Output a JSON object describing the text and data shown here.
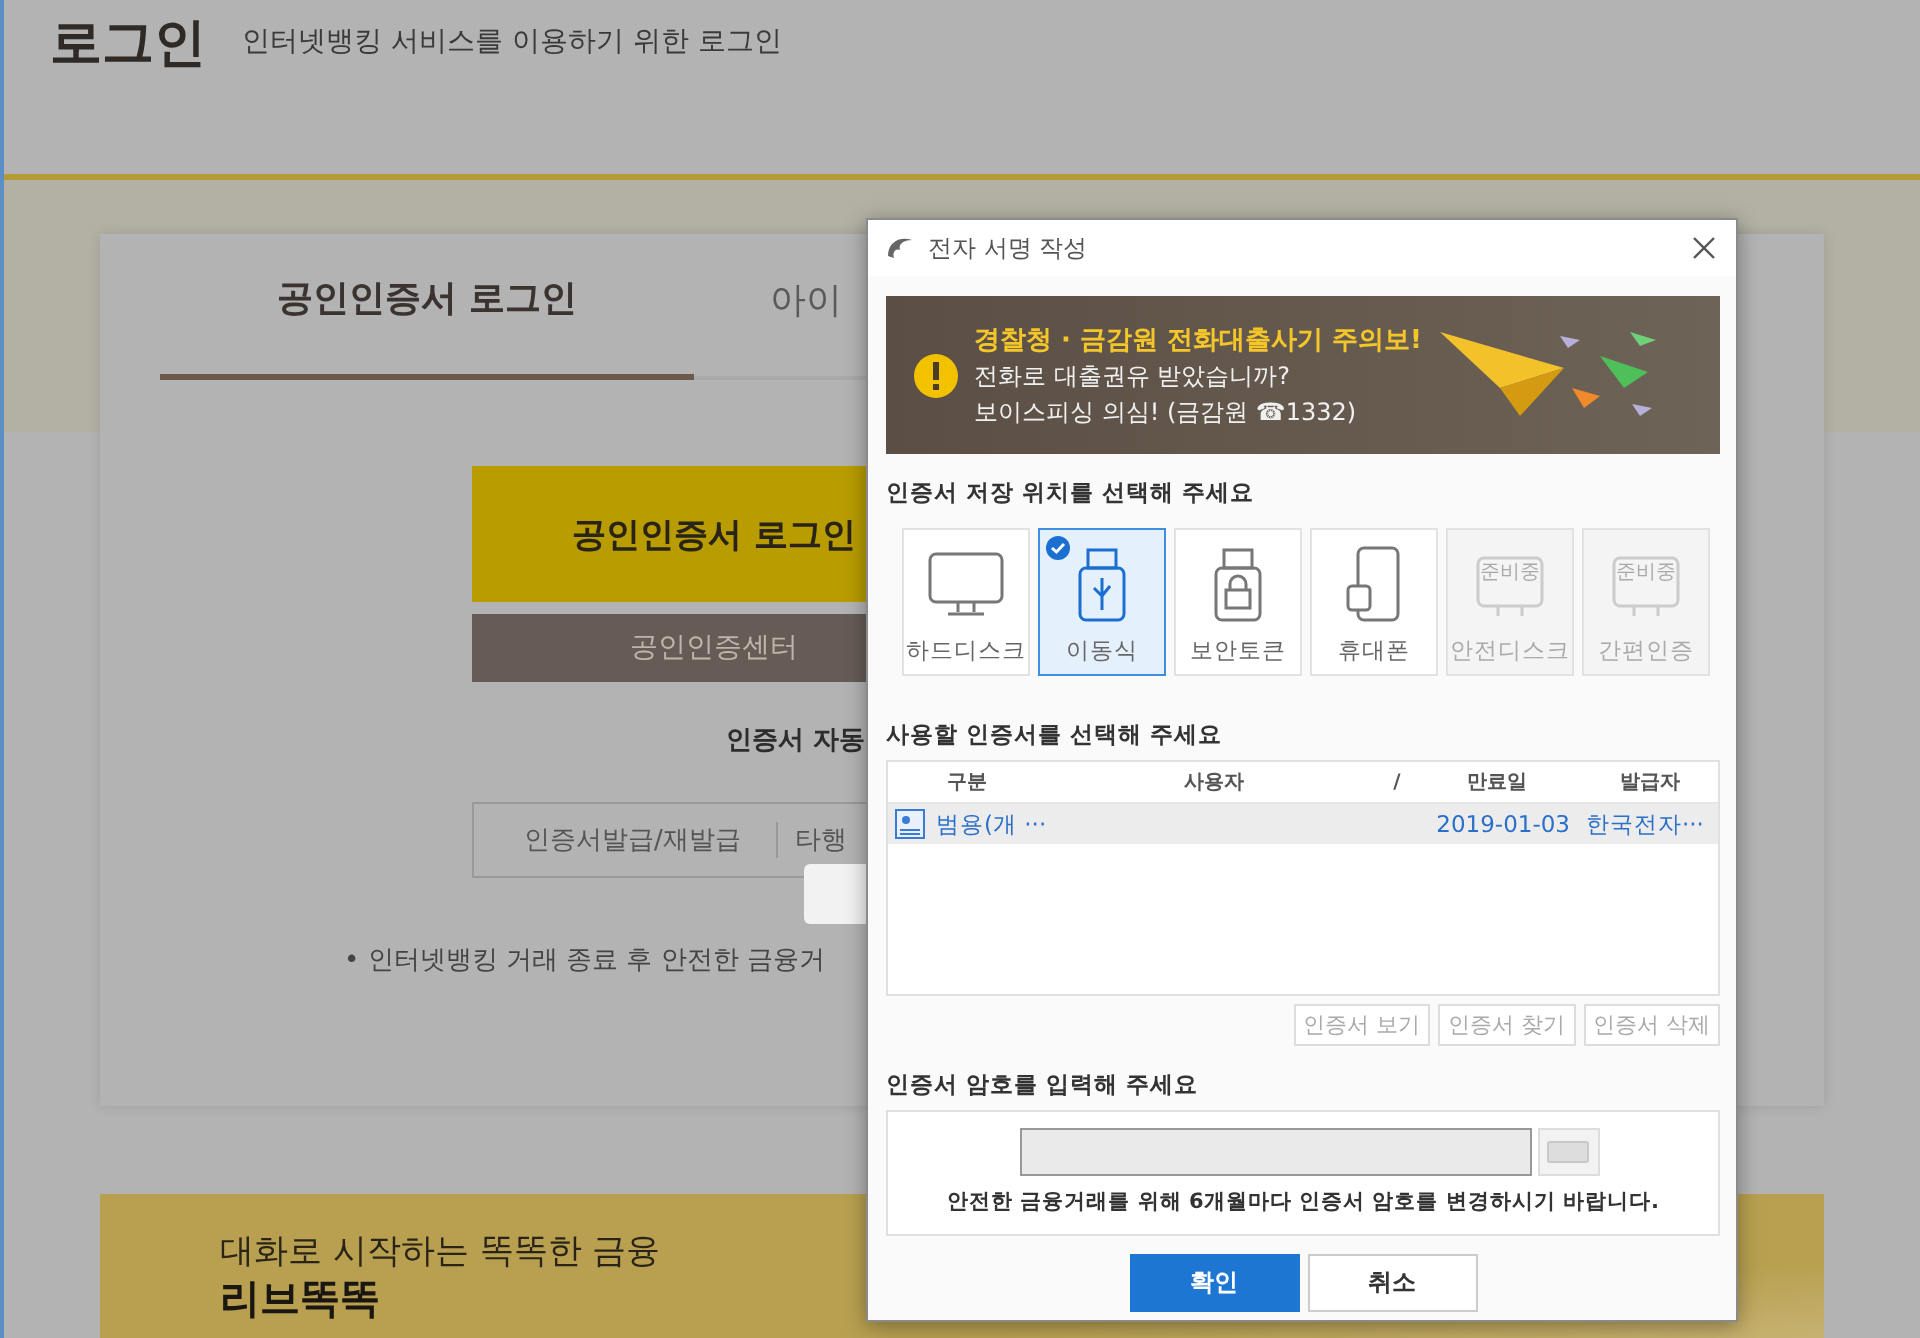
{
  "header": {
    "title": "로그인",
    "subtitle": "인터넷뱅킹 서비스를 이용하기 위한 로그인"
  },
  "login_tabs": [
    {
      "label": "공인인증서 로그인",
      "selected": true
    },
    {
      "label": "아이",
      "selected": false
    }
  ],
  "primary_button": "공인인증서 로그인",
  "center_button": "공인인증센터",
  "auto_label": "인증서 자동",
  "links": [
    "인증서발급/재발급",
    "타행"
  ],
  "notice": "• 인터넷뱅킹 거래 종료 후 안전한 금융거",
  "promo": {
    "line1": "대화로 시작하는 똑똑한 금융",
    "line2": "리브똑똑"
  },
  "dialog": {
    "title": "전자 서명 작성",
    "warning": {
      "headline": "경찰청 · 금감원 전화대출사기 주의보!",
      "lines": [
        "전화로 대출권유 받았습니까?",
        "보이스피싱 의심! (금감원 ☎1332)"
      ]
    },
    "storage_label": "인증서 저장 위치를 선택해 주세요",
    "storage": [
      {
        "label": "하드디스크",
        "kind": "monitor",
        "selected": false,
        "disabled": false
      },
      {
        "label": "이동식",
        "kind": "usb",
        "selected": true,
        "disabled": false
      },
      {
        "label": "보안토큰",
        "kind": "token",
        "selected": false,
        "disabled": false
      },
      {
        "label": "휴대폰",
        "kind": "phone",
        "selected": false,
        "disabled": false
      },
      {
        "label": "안전디스크",
        "kind": "safedisk",
        "selected": false,
        "disabled": true,
        "badge": "준비중"
      },
      {
        "label": "간편인증",
        "kind": "easy",
        "selected": false,
        "disabled": true,
        "badge": "준비중"
      }
    ],
    "cert_label": "사용할 인증서를 선택해 주세요",
    "table": {
      "columns": [
        "구분",
        "사용자",
        "/",
        "만료일",
        "발급자"
      ],
      "rows": [
        {
          "type": "범용(개 ···",
          "expiry": "2019-01-03",
          "issuer": "한국전자···",
          "selected": true
        }
      ]
    },
    "cert_buttons": [
      "인증서 보기",
      "인증서 찾기",
      "인증서 삭제"
    ],
    "password_label": "인증서 암호를 입력해 주세요",
    "password_notice": "안전한 금융거래를 위해 6개월마다 인증서 암호를 변경하시기 바랍니다.",
    "buttons": [
      {
        "label": "확인",
        "kind": "primary"
      },
      {
        "label": "취소",
        "kind": "secondary"
      }
    ]
  }
}
